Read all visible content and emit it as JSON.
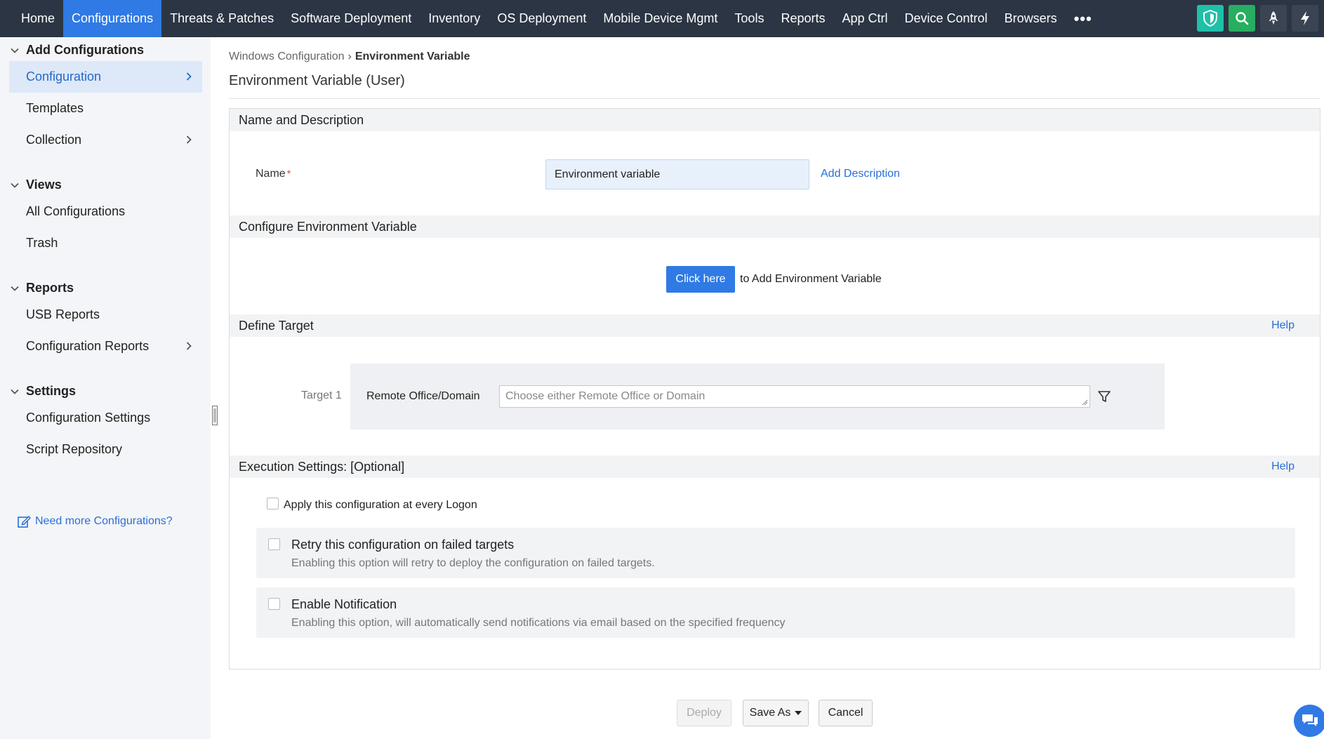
{
  "topnav": {
    "items": [
      {
        "label": "Home"
      },
      {
        "label": "Configurations"
      },
      {
        "label": "Threats & Patches"
      },
      {
        "label": "Software Deployment"
      },
      {
        "label": "Inventory"
      },
      {
        "label": "OS Deployment"
      },
      {
        "label": "Mobile Device Mgmt"
      },
      {
        "label": "Tools"
      },
      {
        "label": "Reports"
      },
      {
        "label": "App Ctrl"
      },
      {
        "label": "Device Control"
      },
      {
        "label": "Browsers"
      }
    ],
    "more_label": "•••",
    "active_color": "#2f7ae5",
    "bg_color": "#2b3544"
  },
  "sidebar": {
    "sections": [
      {
        "title": "Add Configurations",
        "items": [
          {
            "label": "Configuration"
          },
          {
            "label": "Templates"
          },
          {
            "label": "Collection"
          }
        ]
      },
      {
        "title": "Views",
        "items": [
          {
            "label": "All Configurations"
          },
          {
            "label": "Trash"
          }
        ]
      },
      {
        "title": "Reports",
        "items": [
          {
            "label": "USB Reports"
          },
          {
            "label": "Configuration Reports"
          }
        ]
      },
      {
        "title": "Settings",
        "items": [
          {
            "label": "Configuration Settings"
          },
          {
            "label": "Script Repository"
          }
        ]
      }
    ],
    "need_more": "Need more Configurations?"
  },
  "breadcrumb": {
    "parent": "Windows Configuration",
    "separator": "›",
    "current": "Environment Variable"
  },
  "page_title": "Environment Variable (User)",
  "sections": {
    "name_desc": {
      "title": "Name and Description",
      "name_label": "Name",
      "required_mark": "*",
      "name_value": "Environment variable",
      "add_description": "Add Description"
    },
    "configure": {
      "title": "Configure Environment Variable",
      "click_here": "Click here",
      "click_suffix": "to Add Environment Variable"
    },
    "target": {
      "title": "Define Target",
      "help": "Help",
      "target_label": "Target 1",
      "field_label": "Remote Office/Domain",
      "placeholder": "Choose either Remote Office or Domain"
    },
    "execution": {
      "title": "Execution Settings: [Optional]",
      "help": "Help",
      "apply_logon": "Apply this configuration at every Logon",
      "retry_title": "Retry this configuration on failed targets",
      "retry_desc": "Enabling this option will retry to deploy the configuration on failed targets.",
      "notify_title": "Enable Notification",
      "notify_desc": "Enabling this option, will automatically send notifications via email based on the specified frequency"
    }
  },
  "footer": {
    "deploy": "Deploy",
    "save_as": "Save As",
    "cancel": "Cancel"
  }
}
